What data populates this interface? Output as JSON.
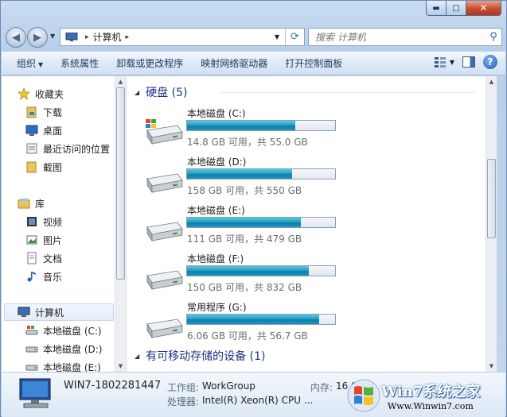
{
  "window": {
    "minimize_glyph": "▬",
    "maximize_glyph": "□",
    "close_glyph": "✕"
  },
  "address": {
    "crumb": "计算机",
    "sep": "▸"
  },
  "search": {
    "placeholder": "搜索 计算机"
  },
  "toolbar": {
    "organize": "组织",
    "system_properties": "系统属性",
    "uninstall": "卸载或更改程序",
    "map_drive": "映射网络驱动器",
    "control_panel": "打开控制面板"
  },
  "nav": {
    "favorites": "收藏夹",
    "downloads": "下载",
    "desktop": "桌面",
    "recent": "最近访问的位置",
    "screenshots": "截图",
    "libraries": "库",
    "videos": "视频",
    "pictures": "图片",
    "documents": "文档",
    "music": "音乐",
    "computer": "计算机",
    "drive_c": "本地磁盘 (C:)",
    "drive_d": "本地磁盘 (D:)",
    "drive_e": "本地磁盘 (E:)"
  },
  "groups": {
    "hdd": "硬盘 (5)",
    "removable": "有可移动存储的设备 (1)"
  },
  "drives": [
    {
      "name": "本地磁盘 (C:)",
      "info": "14.8 GB 可用，共 55.0 GB",
      "used_fraction": 0.73,
      "os": true
    },
    {
      "name": "本地磁盘 (D:)",
      "info": "158 GB 可用，共 550 GB",
      "used_fraction": 0.71,
      "os": false
    },
    {
      "name": "本地磁盘 (E:)",
      "info": "111 GB 可用，共 479 GB",
      "used_fraction": 0.77,
      "os": false
    },
    {
      "name": "本地磁盘 (F:)",
      "info": "150 GB 可用，共 832 GB",
      "used_fraction": 0.82,
      "os": false
    },
    {
      "name": "常用程序 (G:)",
      "info": "6.06 GB 可用，共 56.7 GB",
      "used_fraction": 0.89,
      "os": false
    }
  ],
  "details": {
    "pc_name": "WIN7-1802281447",
    "workgroup_label": "工作组:",
    "workgroup": "WorkGroup",
    "memory_label": "内存:",
    "memory": "16.0 GB",
    "cpu_label": "处理器:",
    "cpu": "Intel(R) Xeon(R) CPU ..."
  },
  "watermark": {
    "brand": "Win7系统之家",
    "url": "Www.Winwin7.com"
  },
  "colors": {
    "bar_fill": "#26a0c4",
    "group_header": "#1e3287",
    "toolbar_text": "#1e395b"
  }
}
